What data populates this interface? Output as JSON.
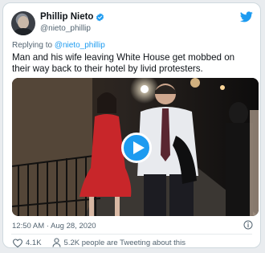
{
  "author": {
    "name": "Phillip Nieto",
    "handle": "@nieto_phillip"
  },
  "reply": {
    "prefix": "Replying to",
    "to": "@nieto_phillip"
  },
  "tweet": {
    "text": "Man and his wife leaving White House get mobbed on their way back to their hotel by livid protesters."
  },
  "timestamp": "12:50 AM · Aug 28, 2020",
  "actions": {
    "likes": "4.1K",
    "tweeting": "5.2K people are Tweeting about this"
  },
  "icons": {
    "verified": "verified-badge-icon",
    "brand": "twitter-bird-icon",
    "play": "play-icon",
    "info": "info-icon",
    "like": "heart-icon",
    "tweeting": "person-icon"
  },
  "colors": {
    "accent": "#1d9bf0",
    "text": "#0f1419",
    "muted": "#536471"
  }
}
